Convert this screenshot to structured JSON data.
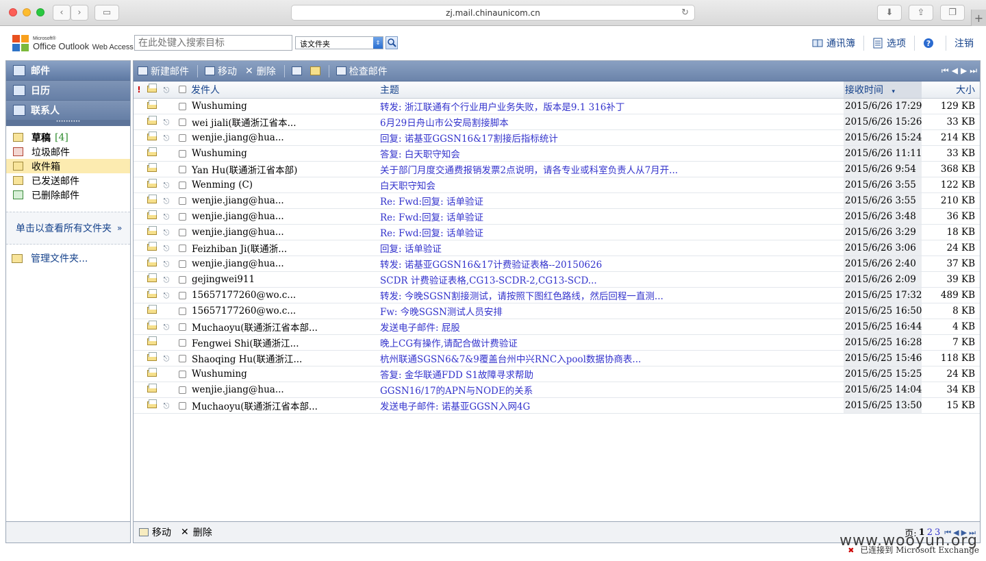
{
  "browser": {
    "url": "zj.mail.chinaunicom.cn",
    "new_tab": "+"
  },
  "header": {
    "logo": {
      "microsoft": "Microsoft®",
      "product": "Office Outlook",
      "web_access": "Web Access"
    },
    "search_placeholder": "在此处键入搜索目标",
    "scope": "该文件夹",
    "links": {
      "address_book": "通讯簿",
      "options": "选项",
      "help": "?",
      "logout": "注销"
    }
  },
  "nav": {
    "sections": [
      {
        "label": "邮件",
        "icon": "mail-icon"
      },
      {
        "label": "日历",
        "icon": "calendar-icon"
      },
      {
        "label": "联系人",
        "icon": "contacts-icon"
      }
    ],
    "folders": [
      {
        "label": "草稿",
        "count": "[4]",
        "icon": "drafts-icon",
        "bold": true
      },
      {
        "label": "垃圾邮件",
        "count": "",
        "icon": "junk-icon"
      },
      {
        "label": "收件箱",
        "count": "",
        "icon": "inbox-icon",
        "selected": true
      },
      {
        "label": "已发送邮件",
        "count": "",
        "icon": "sent-icon"
      },
      {
        "label": "已删除邮件",
        "count": "",
        "icon": "deleted-icon"
      }
    ],
    "view_all": "单击以查看所有文件夹",
    "view_all_arrow": "»",
    "manage": "管理文件夹..."
  },
  "toolbar": {
    "new_mail": "新建邮件",
    "move": "移动",
    "delete": "删除",
    "check_mail": "检查邮件",
    "pager": [
      "⏮",
      "◀",
      "▶",
      "⏭"
    ]
  },
  "columns": {
    "importance": "!",
    "from": "发件人",
    "subject": "主题",
    "received": "接收时间",
    "sort_arrow": "▾",
    "size": "大小"
  },
  "messages": [
    {
      "from": "Wushuming",
      "subject": "转发: 浙江联通有个行业用户业务失败，版本是9.1 316补丁",
      "date": "2015/6/26 17:29",
      "size": "129 KB",
      "attach": false
    },
    {
      "from": "wei jiali(联通浙江省本...",
      "subject": "6月29日舟山市公安局割接脚本",
      "date": "2015/6/26 15:26",
      "size": "33 KB",
      "attach": true
    },
    {
      "from": "wenjie.jiang@hua...",
      "subject": "回复: 诺基亚GGSN16&17割接后指标统计",
      "date": "2015/6/26 15:24",
      "size": "214 KB",
      "attach": true
    },
    {
      "from": "Wushuming",
      "subject": "答复: 白天职守知会",
      "date": "2015/6/26 11:11",
      "size": "33 KB",
      "attach": false
    },
    {
      "from": "Yan Hu(联通浙江省本部)",
      "subject": "关于部门月度交通费报销发票2点说明，请各专业或科室负责人从7月开...",
      "date": "2015/6/26 9:54",
      "size": "368 KB",
      "attach": false
    },
    {
      "from": "Wenming (C)",
      "subject": "白天职守知会",
      "date": "2015/6/26 3:55",
      "size": "122 KB",
      "attach": true
    },
    {
      "from": "wenjie.jiang@hua...",
      "subject": "Re: Fwd:回复: 话单验证",
      "date": "2015/6/26 3:55",
      "size": "210 KB",
      "attach": true
    },
    {
      "from": "wenjie.jiang@hua...",
      "subject": "Re: Fwd:回复: 话单验证",
      "date": "2015/6/26 3:48",
      "size": "36 KB",
      "attach": true
    },
    {
      "from": "wenjie.jiang@hua...",
      "subject": "Re: Fwd:回复: 话单验证",
      "date": "2015/6/26 3:29",
      "size": "18 KB",
      "attach": true
    },
    {
      "from": "Feizhiban Ji(联通浙...",
      "subject": "回复: 话单验证",
      "date": "2015/6/26 3:06",
      "size": "24 KB",
      "attach": true
    },
    {
      "from": "wenjie.jiang@hua...",
      "subject": "转发: 诺基亚GGSN16&17计费验证表格--20150626",
      "date": "2015/6/26 2:40",
      "size": "37 KB",
      "attach": true
    },
    {
      "from": "gejingwei911",
      "subject": "SCDR 计费验证表格,CG13-SCDR-2,CG13-SCD...",
      "date": "2015/6/26 2:09",
      "size": "39 KB",
      "attach": true
    },
    {
      "from": "15657177260@wo.c...",
      "subject": "转发: 今晚SGSN割接测试，请按照下图红色路线，然后回程一直测...",
      "date": "2015/6/25 17:32",
      "size": "489 KB",
      "attach": true
    },
    {
      "from": "15657177260@wo.c...",
      "subject": "Fw: 今晚SGSN测试人员安排",
      "date": "2015/6/25 16:50",
      "size": "8 KB",
      "attach": false
    },
    {
      "from": "Muchaoyu(联通浙江省本部...",
      "subject": "发送电子邮件: 屁股",
      "date": "2015/6/25 16:44",
      "size": "4 KB",
      "attach": true
    },
    {
      "from": "Fengwei Shi(联通浙江...",
      "subject": "晚上CG有操作,请配合做计费验证",
      "date": "2015/6/25 16:28",
      "size": "7 KB",
      "attach": false
    },
    {
      "from": "Shaoqing Hu(联通浙江...",
      "subject": "杭州联通SGSN6&7&9覆盖台州中兴RNC入pool数据协商表...",
      "date": "2015/6/25 15:46",
      "size": "118 KB",
      "attach": true
    },
    {
      "from": "Wushuming",
      "subject": "答复: 金华联通FDD S1故障寻求帮助",
      "date": "2015/6/25 15:25",
      "size": "24 KB",
      "attach": false
    },
    {
      "from": "wenjie.jiang@hua...",
      "subject": "GGSN16/17的APN与NODE的关系",
      "date": "2015/6/25 14:04",
      "size": "34 KB",
      "attach": false
    },
    {
      "from": "Muchaoyu(联通浙江省本部...",
      "subject": "发送电子邮件: 诺基亚GGSN入网4G",
      "date": "2015/6/25 13:50",
      "size": "15 KB",
      "attach": true
    }
  ],
  "bottom": {
    "move": "移动",
    "delete": "删除",
    "page_label": "页:",
    "current_page": "1",
    "pages": [
      "2",
      "3"
    ]
  },
  "status": "已连接到 Microsoft Exchange",
  "watermark": "www.wooyun.org"
}
